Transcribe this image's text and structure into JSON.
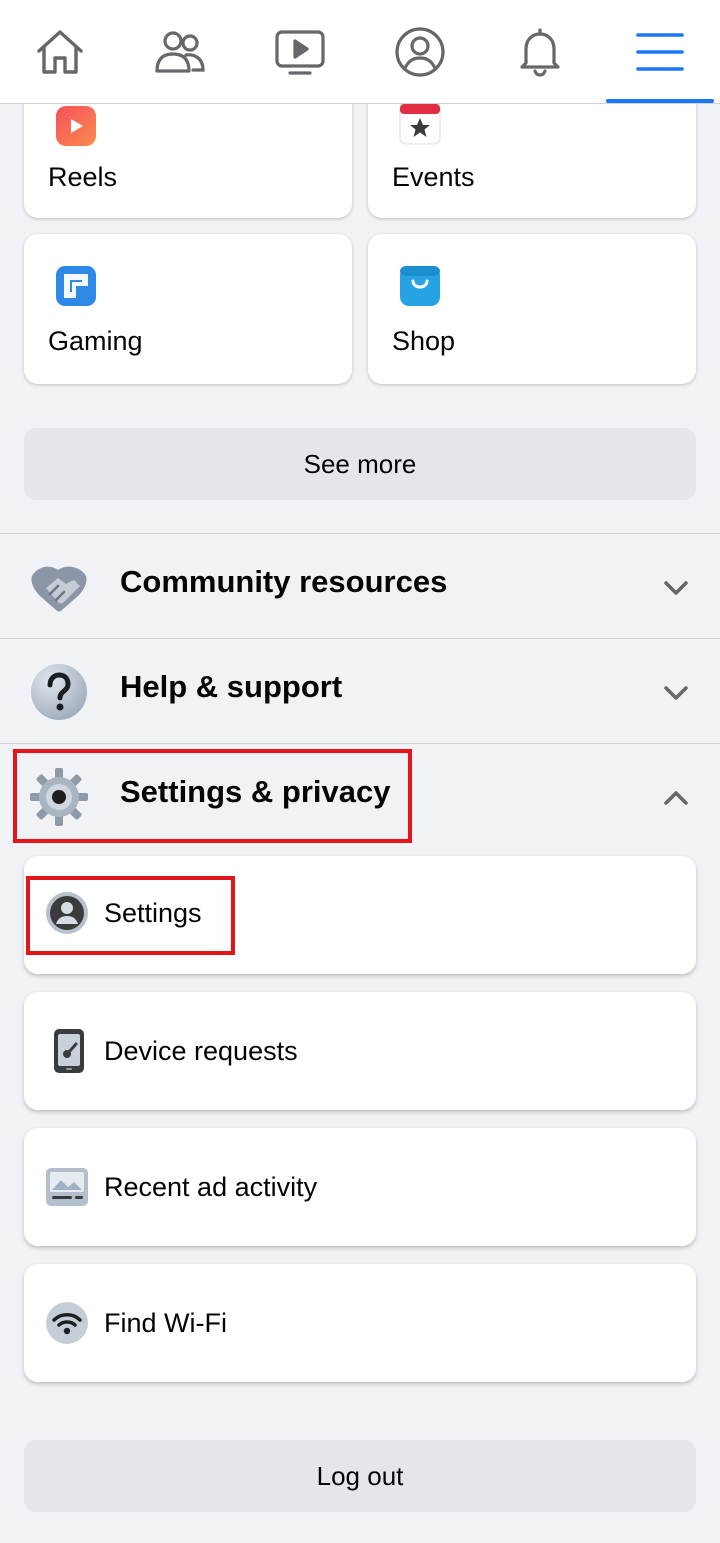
{
  "nav": {
    "items": [
      {
        "icon": "home-icon"
      },
      {
        "icon": "friends-icon"
      },
      {
        "icon": "watch-icon"
      },
      {
        "icon": "profile-icon"
      },
      {
        "icon": "notifications-icon"
      },
      {
        "icon": "menu-icon",
        "active": true
      }
    ],
    "active_color": "#1877f2"
  },
  "shortcuts": [
    {
      "label": "Reels",
      "icon": "reels-icon"
    },
    {
      "label": "Events",
      "icon": "events-icon"
    },
    {
      "label": "Gaming",
      "icon": "gaming-icon"
    },
    {
      "label": "Shop",
      "icon": "shop-icon"
    }
  ],
  "see_more_label": "See more",
  "sections": [
    {
      "label": "Community resources",
      "icon": "handshake-icon",
      "expanded": false
    },
    {
      "label": "Help & support",
      "icon": "question-icon",
      "expanded": false
    },
    {
      "label": "Settings & privacy",
      "icon": "gear-icon",
      "expanded": true
    }
  ],
  "settings_items": [
    {
      "label": "Settings",
      "icon": "user-circle-icon"
    },
    {
      "label": "Device requests",
      "icon": "phone-key-icon"
    },
    {
      "label": "Recent ad activity",
      "icon": "ad-activity-icon"
    },
    {
      "label": "Find Wi-Fi",
      "icon": "wifi-icon"
    }
  ],
  "logout_label": "Log out",
  "highlight_color": "#e4141b"
}
